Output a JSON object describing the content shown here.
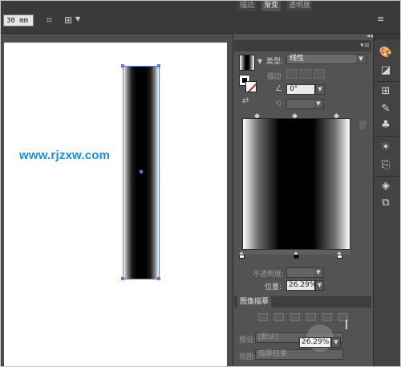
{
  "toolbar": {
    "width_value": "30 mm",
    "transform_icon": "transform-icon",
    "align_icon": "align-icon",
    "menu_icon": "panel-menu-icon"
  },
  "canvas": {
    "watermark": "www.rjzxw.com",
    "artboard_bg": "#ffffff",
    "selection_color": "#5b78d6"
  },
  "gradient_panel": {
    "tabs": [
      {
        "label": "描边",
        "active": false
      },
      {
        "label": "渐变",
        "active": true
      },
      {
        "label": "透明度",
        "active": false
      }
    ],
    "type_label": "类型:",
    "type_value": "线性",
    "stroke_label": "描边",
    "angle_value": "0°",
    "opacity_label": "不透明度:",
    "position_label": "位置:",
    "position_value": "26.29%",
    "stops": [
      {
        "position": 0,
        "color": "#ffffff"
      },
      {
        "position": 50,
        "color": "#000000"
      },
      {
        "position": 100,
        "color": "#ffffff"
      }
    ]
  },
  "trace_panel": {
    "title": "图像描摹",
    "preset_label": "预设:",
    "preset_value": "[默认]",
    "view_label": "视图:",
    "view_value": "描摹结果",
    "zoom_value": "26.29%"
  },
  "right_dock": {
    "icons": [
      "palette-icon",
      "brush-icon",
      "symbols-icon",
      "clubs-icon",
      "appearance-icon",
      "export-icon",
      "layers-icon",
      "artboards-icon"
    ]
  }
}
